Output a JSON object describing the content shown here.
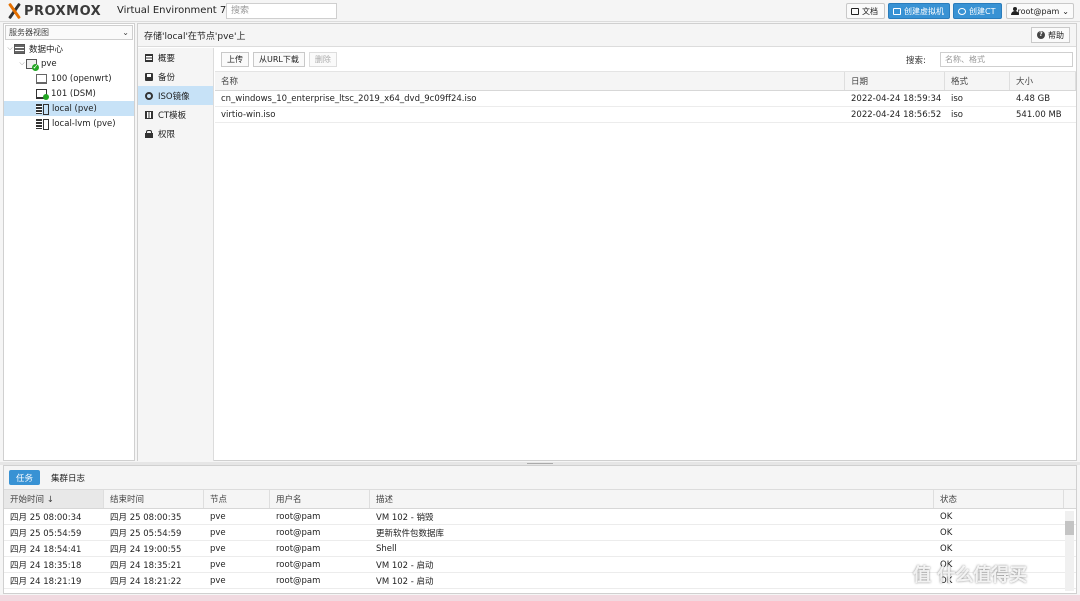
{
  "header": {
    "logo": "PROXMOX",
    "version": "Virtual Environment 7.1-7",
    "search_placeholder": "搜索",
    "docs_label": "文档",
    "create_vm_label": "创建虚拟机",
    "create_ct_label": "创建CT",
    "user_label": "root@pam"
  },
  "tree": {
    "view_label": "服务器视图",
    "items": [
      {
        "label": "数据中心"
      },
      {
        "label": "pve"
      },
      {
        "label": "100 (openwrt)"
      },
      {
        "label": "101 (DSM)"
      },
      {
        "label": "local (pve)"
      },
      {
        "label": "local-lvm (pve)"
      }
    ]
  },
  "content": {
    "title": "存储'local'在节点'pve'上",
    "help_label": "帮助",
    "nav": [
      {
        "label": "概要"
      },
      {
        "label": "备份"
      },
      {
        "label": "ISO镜像"
      },
      {
        "label": "CT模板"
      },
      {
        "label": "权限"
      }
    ],
    "toolbar": {
      "upload_label": "上传",
      "download_url_label": "从URL下载",
      "delete_label": "删除",
      "search_label": "搜索:",
      "search_placeholder": "名称、格式"
    },
    "columns": {
      "name": "名称",
      "date": "日期",
      "format": "格式",
      "size": "大小"
    },
    "rows": [
      {
        "name": "cn_windows_10_enterprise_ltsc_2019_x64_dvd_9c09ff24.iso",
        "date": "2022-04-24 18:59:34",
        "format": "iso",
        "size": "4.48 GB"
      },
      {
        "name": "virtio-win.iso",
        "date": "2022-04-24 18:56:52",
        "format": "iso",
        "size": "541.00 MB"
      }
    ]
  },
  "tasks": {
    "tabs": [
      {
        "label": "任务"
      },
      {
        "label": "集群日志"
      }
    ],
    "columns": {
      "start": "开始时间 ↓",
      "end": "结束时间",
      "node": "节点",
      "user": "用户名",
      "desc": "描述",
      "status": "状态"
    },
    "rows": [
      {
        "start": "四月 25 08:00:34",
        "end": "四月 25 08:00:35",
        "node": "pve",
        "user": "root@pam",
        "desc": "VM 102 - 销毁",
        "status": "OK"
      },
      {
        "start": "四月 25 05:54:59",
        "end": "四月 25 05:54:59",
        "node": "pve",
        "user": "root@pam",
        "desc": "更新软件包数据库",
        "status": "OK"
      },
      {
        "start": "四月 24 18:54:41",
        "end": "四月 24 19:00:55",
        "node": "pve",
        "user": "root@pam",
        "desc": "Shell",
        "status": "OK"
      },
      {
        "start": "四月 24 18:35:18",
        "end": "四月 24 18:35:21",
        "node": "pve",
        "user": "root@pam",
        "desc": "VM 102 - 启动",
        "status": "OK"
      },
      {
        "start": "四月 24 18:21:19",
        "end": "四月 24 18:21:22",
        "node": "pve",
        "user": "root@pam",
        "desc": "VM 102 - 启动",
        "status": "OK"
      }
    ]
  },
  "watermark": "值 什么值得买",
  "colors": {
    "accent": "#3892d4",
    "selection": "#c7e2f7",
    "logo_orange": "#e57000"
  }
}
